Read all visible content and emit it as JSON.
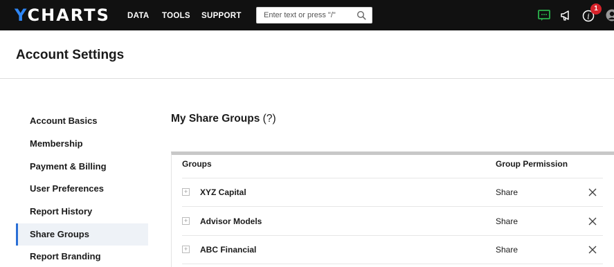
{
  "nav": {
    "logo_prefix": "Y",
    "logo_rest": "CHARTS",
    "links": [
      "DATA",
      "TOOLS",
      "SUPPORT"
    ],
    "search_placeholder": "Enter text or press \"/\"",
    "notification_count": "1",
    "icons": [
      "chat-icon",
      "megaphone-icon",
      "info-icon",
      "user-icon"
    ],
    "colors": {
      "background": "#111111",
      "logo_accent": "#2e86f5",
      "chat_icon": "#2bb24c",
      "badge": "#d6222a"
    }
  },
  "page": {
    "title": "Account Settings"
  },
  "sidebar": {
    "items": [
      {
        "label": "Account Basics"
      },
      {
        "label": "Membership"
      },
      {
        "label": "Payment & Billing"
      },
      {
        "label": "User Preferences"
      },
      {
        "label": "Report History"
      },
      {
        "label": "Share Groups",
        "active": true
      },
      {
        "label": "Report Branding"
      }
    ],
    "active_color": "#2a6fd6"
  },
  "main": {
    "section_title": "My Share Groups",
    "help_label": "(?)",
    "columns": [
      "Groups",
      "Group Permission"
    ],
    "rows": [
      {
        "expand": "+",
        "name": "XYZ Capital",
        "permission": "Share"
      },
      {
        "expand": "+",
        "name": "Advisor Models",
        "permission": "Share"
      },
      {
        "expand": "+",
        "name": "ABC Financial",
        "permission": "Share"
      }
    ]
  }
}
